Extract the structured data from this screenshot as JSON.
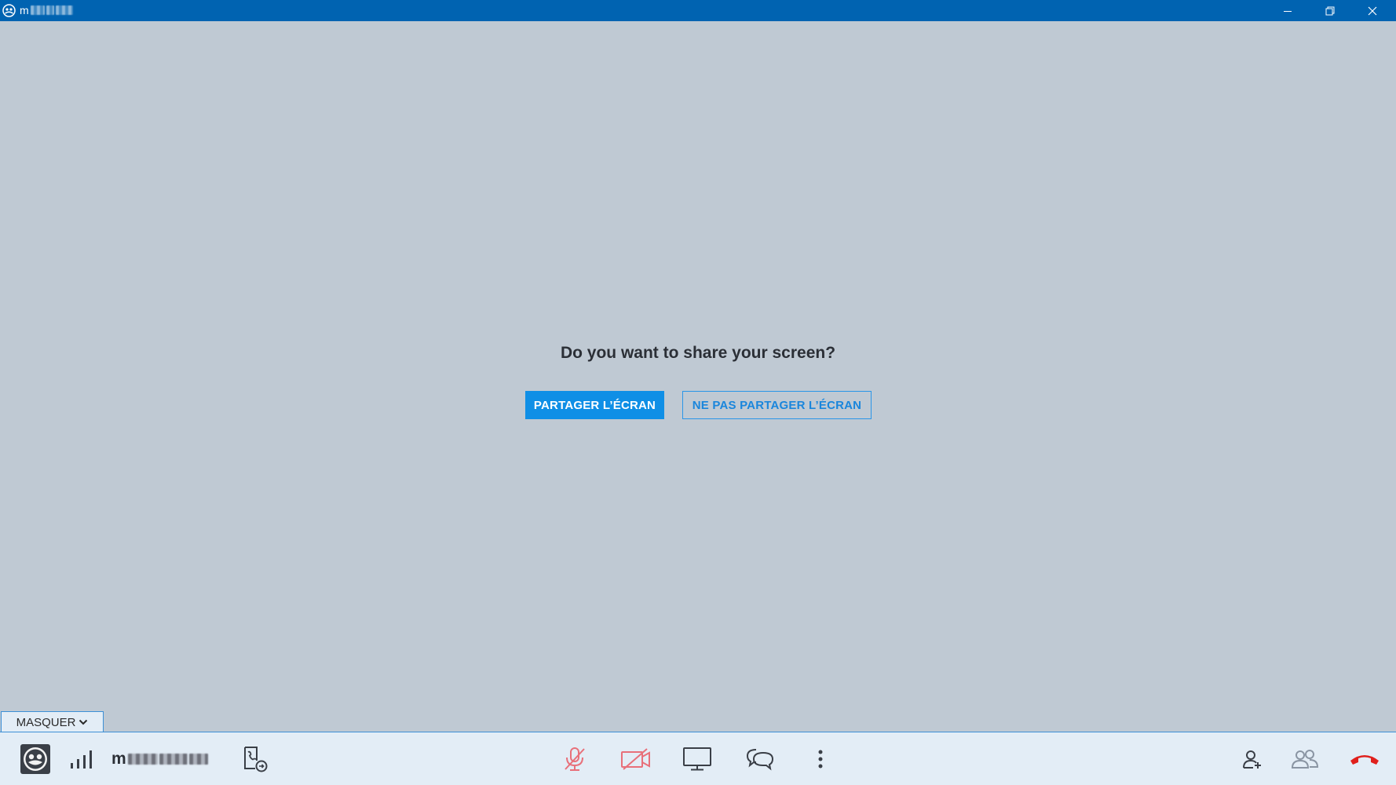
{
  "window": {
    "title_prefix": "m",
    "minimize_label": "Minimize",
    "restore_label": "Restore",
    "close_label": "Close"
  },
  "prompt": {
    "question": "Do you want to share your screen?",
    "share_button": "PARTAGER L’ÉCRAN",
    "no_share_button": "NE PAS PARTAGER L’ÉCRAN"
  },
  "masquer": {
    "label": "MASQUER"
  },
  "toolbar": {
    "caller_name_prefix": "m",
    "left_icons": [
      "avatar-icon",
      "signal-strength-icon",
      "call-transfer-icon"
    ],
    "center_icons": [
      "microphone-muted-icon",
      "camera-off-icon",
      "screen-share-icon",
      "chat-icon",
      "more-options-icon"
    ],
    "right_icons": [
      "add-participant-icon",
      "participants-icon",
      "hang-up-icon"
    ]
  },
  "colors": {
    "titlebar": "#0063b1",
    "background": "#bfc9d3",
    "primary_button": "#0f8fe6",
    "toolbar": "#e3edf6",
    "muted_red": "#e8707a",
    "hangup_red": "#e0201c"
  }
}
